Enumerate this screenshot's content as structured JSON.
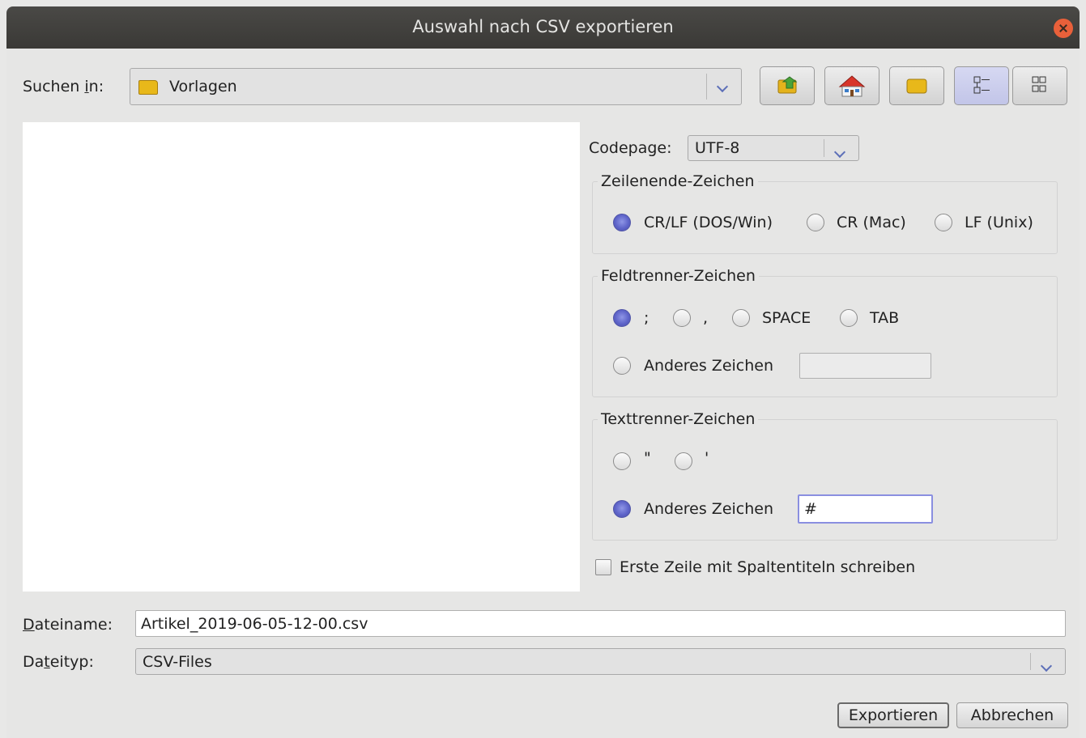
{
  "window": {
    "title": "Auswahl nach CSV exportieren"
  },
  "lookin": {
    "label": "Suchen in:",
    "value": "Vorlagen"
  },
  "toolbar": {
    "buttons": [
      "up-folder",
      "home",
      "new-folder",
      "list-view",
      "details-view"
    ]
  },
  "codepage": {
    "label": "Codepage:",
    "value": "UTF-8"
  },
  "line_end": {
    "title": "Zeilenende-Zeichen",
    "options": [
      "CR/LF (DOS/Win)",
      "CR (Mac)",
      "LF (Unix)"
    ],
    "selected": "CR/LF (DOS/Win)"
  },
  "field_sep": {
    "title": "Feldtrenner-Zeichen",
    "options": [
      ";",
      ",",
      "SPACE",
      "TAB"
    ],
    "other_label": "Anderes Zeichen",
    "other_value": "",
    "selected": ";"
  },
  "text_sep": {
    "title": "Texttrenner-Zeichen",
    "options": [
      "\"",
      "'"
    ],
    "other_label": "Anderes Zeichen",
    "other_value": "#",
    "selected": "Anderes Zeichen"
  },
  "header_row": {
    "label": "Erste Zeile mit Spaltentiteln schreiben",
    "checked": false
  },
  "filename": {
    "label": "Dateiname:",
    "value": "Artikel_2019-06-05-12-00.csv"
  },
  "filetype": {
    "label": "Dateityp:",
    "value": "CSV-Files"
  },
  "buttons": {
    "export": "Exportieren",
    "cancel": "Abbrechen"
  }
}
